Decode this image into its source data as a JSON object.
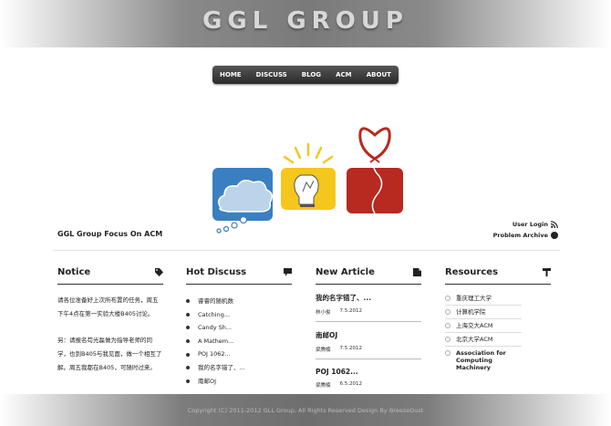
{
  "header": {
    "logo_text": "GGL GROUP"
  },
  "nav": {
    "items": [
      "HOME",
      "DISCUSS",
      "BLOG",
      "ACM",
      "ABOUT"
    ]
  },
  "tagline": "GGL Group Focus On ACM",
  "side_links": {
    "user_login": "User Login",
    "problem_archive": "Problem Archive"
  },
  "notice": {
    "title": "Notice",
    "paragraphs": [
      "请各位准备好上次所布置的任务，周五下午4点在第一实验大楼B405讨论。",
      "另：请报名苟光磊做为指导老师的同学，也到B405与我见面，做一个相互了解。周五我都在B405，可随时过来。"
    ]
  },
  "hot_discuss": {
    "title": "Hot Discuss",
    "items": [
      "睿睿的随机数",
      "Catching...",
      "Candy Sh...",
      "A Mathem...",
      "POJ 1062...",
      "我的名字错了、...",
      "南邮OJ"
    ]
  },
  "new_article": {
    "title": "New Article",
    "items": [
      {
        "title": "我的名字错了、...",
        "author": "林小俊",
        "date": "7.5.2012"
      },
      {
        "title": "南邮OJ",
        "author": "梁腾楠",
        "date": "7.5.2012"
      },
      {
        "title": "POJ 1062...",
        "author": "梁腾楠",
        "date": "6.5.2012"
      }
    ]
  },
  "resources": {
    "title": "Resources",
    "items": [
      "重庆理工大学",
      "计算机学院",
      "上海交大ACM",
      "北京大学ACM",
      "Association for Computing Machinery"
    ]
  },
  "footer": {
    "text": "Copyright (C) 2011-2012  GLL Group, All Rights Reserved   Design By  BreezeDust"
  },
  "colors": {
    "blue": "#3a7fc1",
    "yellow": "#f5c61b",
    "red": "#b8291f"
  }
}
